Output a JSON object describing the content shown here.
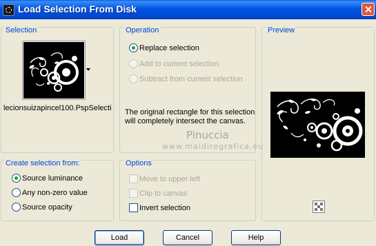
{
  "window": {
    "title": "Load Selection From Disk"
  },
  "selection": {
    "group_label": "Selection",
    "filename": "lecionsuizapincel100.PspSelecti"
  },
  "operation": {
    "group_label": "Operation",
    "options": [
      {
        "label": "Replace selection",
        "checked": true,
        "enabled": true
      },
      {
        "label": "Add to current selection",
        "checked": false,
        "enabled": false
      },
      {
        "label": "Subtract from current selection",
        "checked": false,
        "enabled": false
      }
    ],
    "description": "The original rectangle for this selection will completely intersect the canvas."
  },
  "preview": {
    "group_label": "Preview"
  },
  "create_from": {
    "group_label": "Create selection from:",
    "options": [
      {
        "label": "Source luminance",
        "checked": true
      },
      {
        "label": "Any non-zero value",
        "checked": false
      },
      {
        "label": "Source opacity",
        "checked": false
      }
    ]
  },
  "options": {
    "group_label": "Options",
    "items": [
      {
        "label": "Move to upper left",
        "checked": false,
        "enabled": false
      },
      {
        "label": "Clip to canvas",
        "checked": false,
        "enabled": false
      },
      {
        "label": "Invert selection",
        "checked": false,
        "enabled": true
      }
    ]
  },
  "watermark": {
    "name": "Pinuccia",
    "url": "www.maidiregrafica.eu"
  },
  "buttons": {
    "load": "Load",
    "cancel": "Cancel",
    "help": "Help"
  },
  "colors": {
    "titlebar": "#0054e3",
    "group_label": "#0046d5",
    "dialog_bg": "#ece9d8",
    "radio_dot": "#21a121"
  }
}
